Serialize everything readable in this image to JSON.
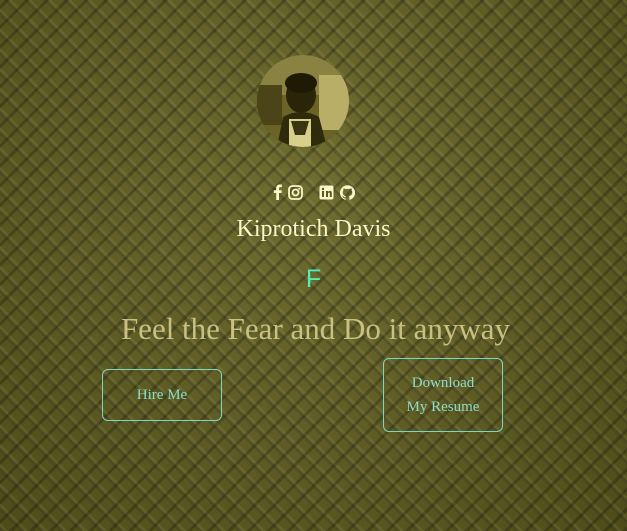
{
  "profile": {
    "name": "Kiprotich Davis",
    "avatar_icon": "profile-photo"
  },
  "socials": [
    {
      "icon": "facebook-icon"
    },
    {
      "icon": "instagram-icon"
    },
    {
      "icon": "linkedin-icon"
    },
    {
      "icon": "github-icon"
    }
  ],
  "typed_text": "F",
  "tagline": "Feel the Fear and Do it anyway",
  "buttons": {
    "hire_label": "Hire Me",
    "resume_line1": "Download",
    "resume_line2": "My Resume"
  },
  "colors": {
    "background": "#5c5a22",
    "name_text": "#fbf6c8",
    "typed_text": "#4ff0b4",
    "tagline_text": "#c9c184",
    "button_border": "#7fd6c0"
  }
}
